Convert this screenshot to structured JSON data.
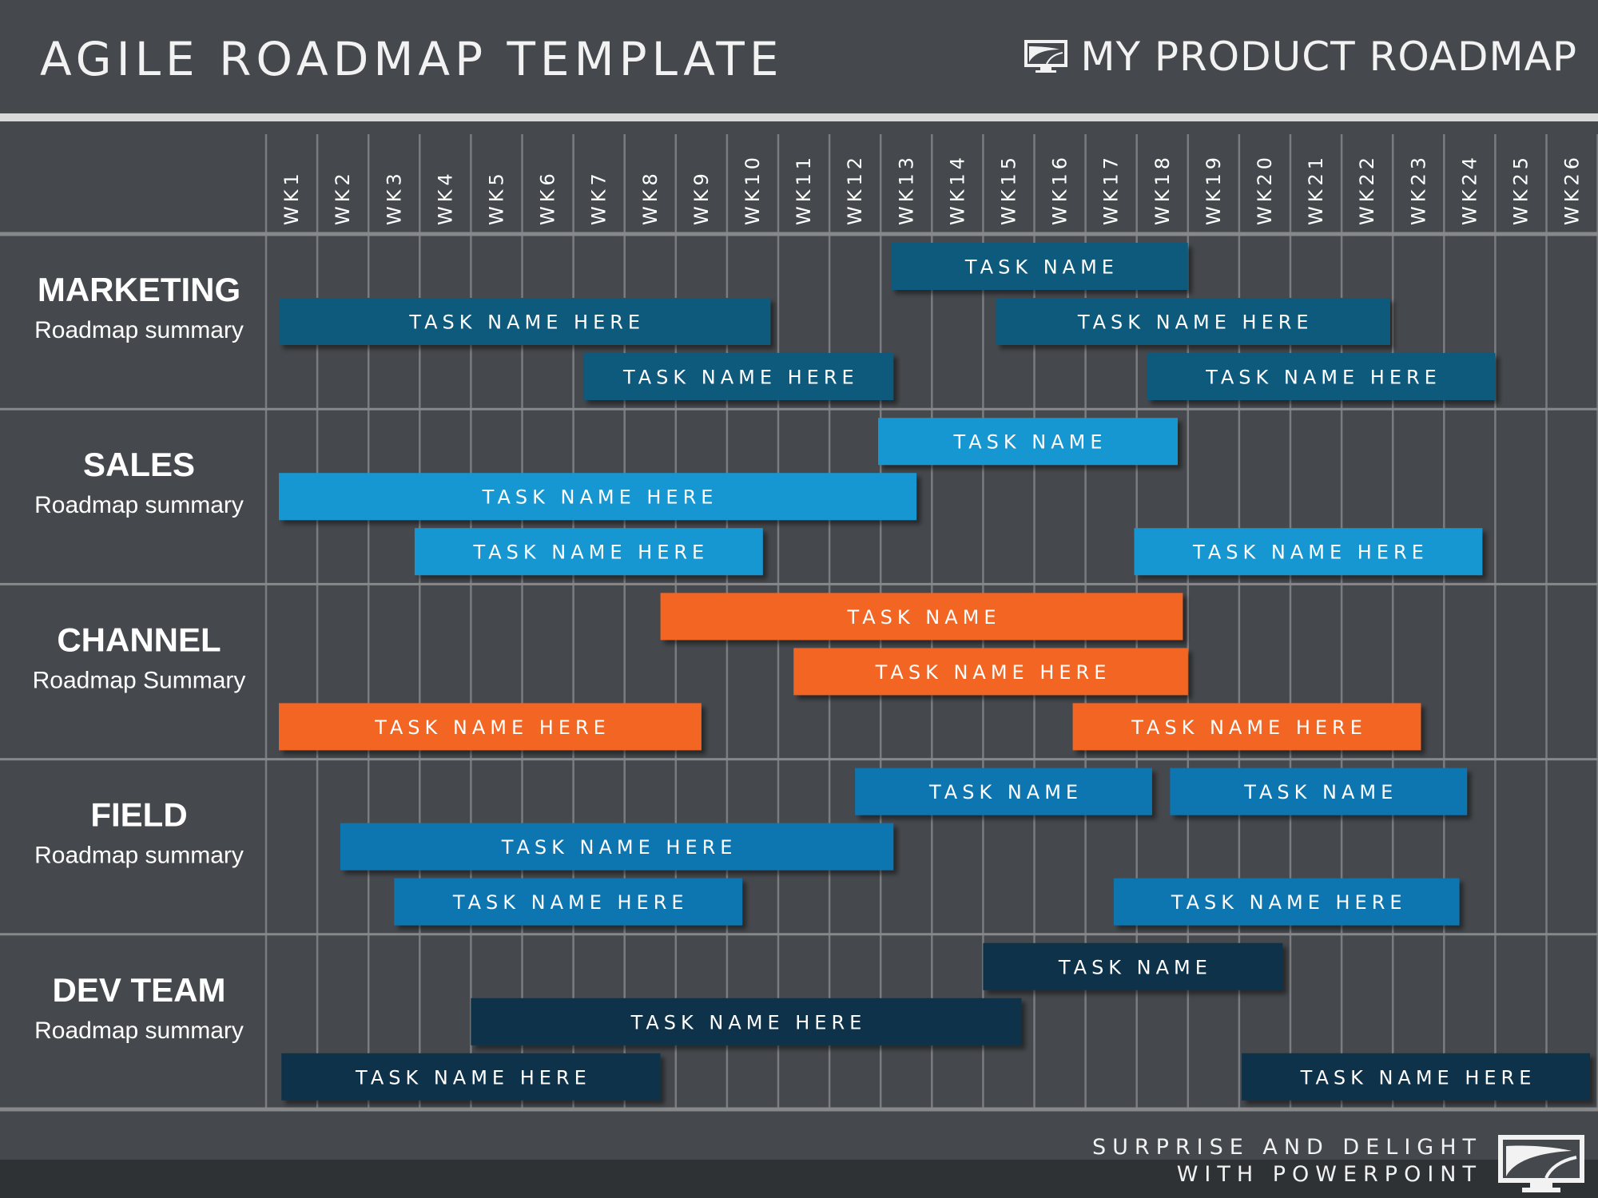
{
  "header": {
    "title": "AGILE ROADMAP TEMPLATE",
    "brand": "MY PRODUCT  ROADMAP",
    "brand_icon": "road-monitor-icon"
  },
  "footer": {
    "line1": "SURPRISE AND DELIGHT",
    "line2": "WITH POWERPOINT",
    "icon": "road-monitor-icon"
  },
  "chart_data": {
    "type": "gantt",
    "title": "AGILE ROADMAP TEMPLATE",
    "x_unit": "week",
    "weeks": [
      "WK1",
      "WK2",
      "WK3",
      "WK4",
      "WK5",
      "WK6",
      "WK7",
      "WK8",
      "WK9",
      "WK10",
      "WK11",
      "WK12",
      "WK13",
      "WK14",
      "WK15",
      "WK16",
      "WK17",
      "WK18",
      "WK19",
      "WK20",
      "WK21",
      "WK22",
      "WK23",
      "WK24",
      "WK25",
      "WK26"
    ],
    "grid": true,
    "categories": [
      {
        "name": "MARKETING",
        "summary": "Roadmap summary",
        "color": "#0f5a7d",
        "tasks": [
          {
            "label": "TASK NAME",
            "start": 12.2,
            "end": 18.0,
            "lane": 0
          },
          {
            "label": "TASK NAME HERE",
            "start": 0.25,
            "end": 9.85,
            "lane": 1
          },
          {
            "label": "TASK NAME HERE",
            "start": 14.25,
            "end": 21.95,
            "lane": 1
          },
          {
            "label": "TASK NAME HERE",
            "start": 6.2,
            "end": 12.25,
            "lane": 2
          },
          {
            "label": "TASK NAME HERE",
            "start": 17.2,
            "end": 24.0,
            "lane": 2
          }
        ]
      },
      {
        "name": "SALES",
        "summary": "Roadmap summary",
        "color": "#1897d1",
        "tasks": [
          {
            "label": "TASK NAME",
            "start": 11.95,
            "end": 17.8,
            "lane": 0
          },
          {
            "label": "TASK NAME HERE",
            "start": 0.25,
            "end": 12.7,
            "lane": 1
          },
          {
            "label": "TASK NAME HERE",
            "start": 2.9,
            "end": 9.7,
            "lane": 2
          },
          {
            "label": "TASK NAME HERE",
            "start": 16.95,
            "end": 23.75,
            "lane": 2
          }
        ]
      },
      {
        "name": "CHANNEL",
        "summary": "Roadmap Summary",
        "color": "#f26522",
        "tasks": [
          {
            "label": "TASK NAME",
            "start": 7.7,
            "end": 17.9,
            "lane": 0
          },
          {
            "label": "TASK NAME HERE",
            "start": 10.3,
            "end": 18.0,
            "lane": 1
          },
          {
            "label": "TASK NAME HERE",
            "start": 0.25,
            "end": 8.5,
            "lane": 2
          },
          {
            "label": "TASK NAME HERE",
            "start": 15.75,
            "end": 22.55,
            "lane": 2
          }
        ]
      },
      {
        "name": "FIELD",
        "summary": "Roadmap summary",
        "color": "#0a75b0",
        "tasks": [
          {
            "label": "TASK NAME",
            "start": 11.5,
            "end": 17.3,
            "lane": 0
          },
          {
            "label": "TASK NAME",
            "start": 17.65,
            "end": 23.45,
            "lane": 0
          },
          {
            "label": "TASK NAME HERE",
            "start": 1.45,
            "end": 12.25,
            "lane": 1
          },
          {
            "label": "TASK NAME HERE",
            "start": 2.5,
            "end": 9.3,
            "lane": 2
          },
          {
            "label": "TASK NAME HERE",
            "start": 16.55,
            "end": 23.3,
            "lane": 2
          }
        ]
      },
      {
        "name": "DEV TEAM",
        "summary": "Roadmap summary",
        "color": "#0e3048",
        "tasks": [
          {
            "label": "TASK NAME",
            "start": 14.0,
            "end": 19.85,
            "lane": 0
          },
          {
            "label": "TASK NAME HERE",
            "start": 4.0,
            "end": 14.75,
            "lane": 1
          },
          {
            "label": "TASK NAME HERE",
            "start": 0.3,
            "end": 7.7,
            "lane": 2
          },
          {
            "label": "TASK NAME HERE",
            "start": 19.05,
            "end": 25.85,
            "lane": 2
          }
        ]
      }
    ]
  }
}
